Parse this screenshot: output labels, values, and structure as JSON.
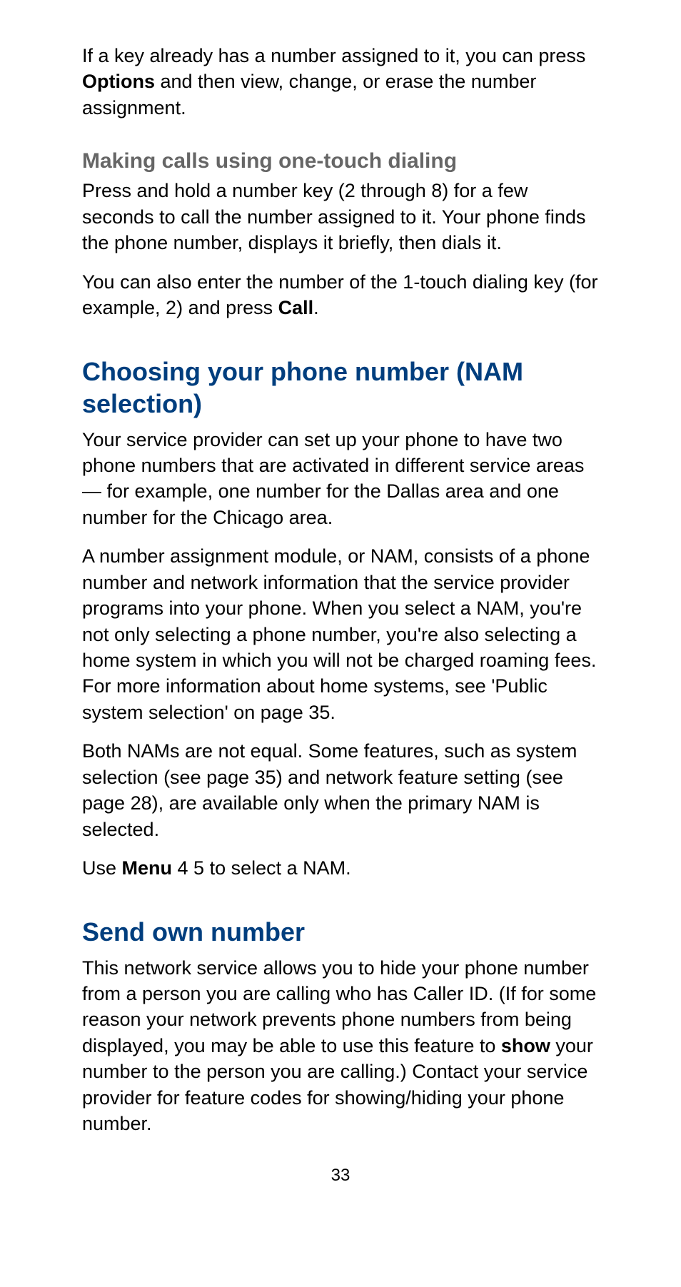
{
  "p1_pre": "If a key already has a number assigned to it, you can press ",
  "p1_bold": "Options",
  "p1_post": " and then view, change, or erase the number assignment.",
  "sub1": "Making calls using one-touch dialing",
  "p2": "Press and hold a number key (2 through 8) for a few seconds to call the number assigned to it. Your phone finds the phone number, displays it briefly, then dials it.",
  "p3_pre": "You can also enter the number of the 1-touch dialing key (for example, 2) and press ",
  "p3_bold": "Call",
  "p3_post": ".",
  "h2a": "Choosing your phone number (NAM selection)",
  "p4": "Your service provider can set up your phone to have two phone numbers that are activated in different service areas — for example, one number for the Dallas area and one number for the Chicago area.",
  "p5": "A number assignment module, or NAM, consists of a phone number and network information that the service provider programs into your phone. When you select a NAM, you're not only selecting a phone number, you're also selecting a home system in which you will not be charged roaming fees. For more information about home systems, see 'Public system selection' on page 35.",
  "p6": "Both NAMs are not equal. Some features, such as system selection (see page 35) and network feature setting (see page 28), are available only when the primary NAM is selected.",
  "p7_pre": "Use ",
  "p7_bold": "Menu",
  "p7_post": " 4 5 to select a NAM.",
  "h2b": "Send own number",
  "p8_pre": "This network service allows you to hide your phone number from a person you are calling who has Caller ID. (If for some reason your network prevents phone numbers from being displayed, you may be able to use this feature to ",
  "p8_bold": "show",
  "p8_post": " your number to the person you are calling.) Contact your service provider for feature codes for showing/hiding your phone number.",
  "page_num": "33"
}
